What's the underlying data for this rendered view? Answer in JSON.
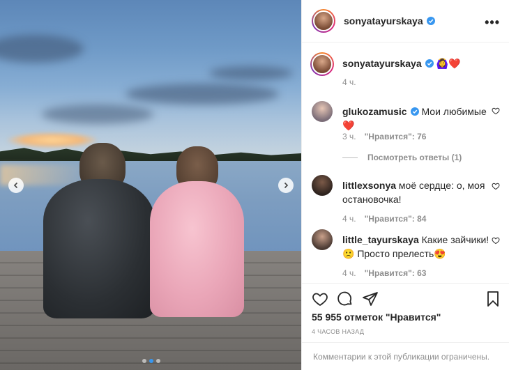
{
  "post": {
    "author": "sonyatayurskaya",
    "more_label": "•••"
  },
  "caption": {
    "username": "sonyatayurskaya",
    "text": "🙆‍♀️❤️",
    "time": "4 ч."
  },
  "comments": [
    {
      "username": "glukozamusic",
      "verified": true,
      "text": "Мои любимые ❤️",
      "time": "3 ч.",
      "likes": "\"Нравится\": 76",
      "replies": "Посмотреть ответы (1)"
    },
    {
      "username": "littlexsonya",
      "verified": false,
      "text": "моё сердце: о, моя остановочка!",
      "time": "4 ч.",
      "likes": "\"Нравится\": 84"
    },
    {
      "username": "little_tayurskaya",
      "verified": false,
      "text": "Какие зайчики! 🙁 Просто прелесть😍",
      "time": "4 ч.",
      "likes": "\"Нравится\": 63"
    }
  ],
  "stats": {
    "likes": "55 955 отметок \"Нравится\"",
    "time_ago": "4 ЧАСОВ НАЗАД"
  },
  "footer": {
    "restricted": "Комментарии к этой публикации ограничены."
  },
  "carousel": {
    "current_index": 2,
    "total": 3
  },
  "colors": {
    "verified": "#3897f0",
    "muted": "#8e8e8e",
    "text": "#262626"
  }
}
